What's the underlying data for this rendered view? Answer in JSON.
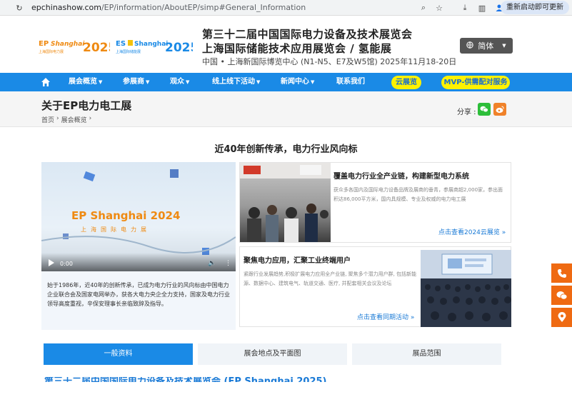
{
  "browser": {
    "url_host": "epchinashow.com",
    "url_path": "/EP/information/AboutEP/simp#General_Information",
    "restart_label": "重新启动即可更新"
  },
  "header": {
    "logo1_text": "EP Shanghai 2025",
    "logo1_sub": "上海国际电力展",
    "logo2_text": "ES Shanghai 2025",
    "logo2_sub": "上海国际储能展",
    "title_line1": "第三十二届中国国际电力设备及技术展览会",
    "title_line2": "上海国际储能技术应用展览会 / 氢能展",
    "title_line3": "中国 • 上海新国际博览中心 (N1-N5、E7及W5馆) 2025年11月18-20日",
    "lang_label": "简体"
  },
  "nav": {
    "items": [
      "展会概览",
      "参展商",
      "观众",
      "线上线下活动",
      "新闻中心",
      "联系我们"
    ],
    "pill_cloud": "云展览",
    "pill_mvp": "MVP-供需配对服务"
  },
  "page": {
    "title": "关于EP电力电工展",
    "breadcrumb": [
      "首页",
      "展会概览"
    ],
    "share_label": "分享 :"
  },
  "section": {
    "heading": "近40年创新传承，电力行业风向标",
    "video_logo": "EP Shanghai 2024",
    "video_logo_sub": "上海国际电力展",
    "video_time": "0:00",
    "intro": "始于1986年，近40年的创新传承，已成为电力行业的风向标由中国电力企业联合会及国家电网举办，获各大电力央企全力支持，国家及电力行业领导高度重视，辛保安理事长亲临致辞及指导。"
  },
  "cards": [
    {
      "title": "覆盖电力行业全产业链，构建新型电力系统",
      "text": "获众多各国内及国际电力设备品牌及展商的垂青，参展商超2,000家，参出面积达86,000平方米，国内具规模、专业及权威的电力电工展",
      "link": "点击查看2024云展览"
    },
    {
      "title": "聚焦电力应用，汇聚工业终端用户",
      "text": "紧跟行业发展趋势,积极扩展电力应用全产业链, 聚焦多个潜力用户群, 包括新能源、数据中心、建筑电气、轨道交通、医疗, 并配套相关会议及论坛",
      "link": "点击查看同期活动"
    }
  ],
  "tabs": [
    "一般资料",
    "展会地点及平面图",
    "展品范围"
  ],
  "bottom_heading": "第三十二届中国国际电力设备及技术展览会 (EP Shanghai 2025)",
  "colors": {
    "brand_blue": "#1a8ae6",
    "accent_orange": "#ef6a12",
    "pill_yellow": "#fff200"
  }
}
